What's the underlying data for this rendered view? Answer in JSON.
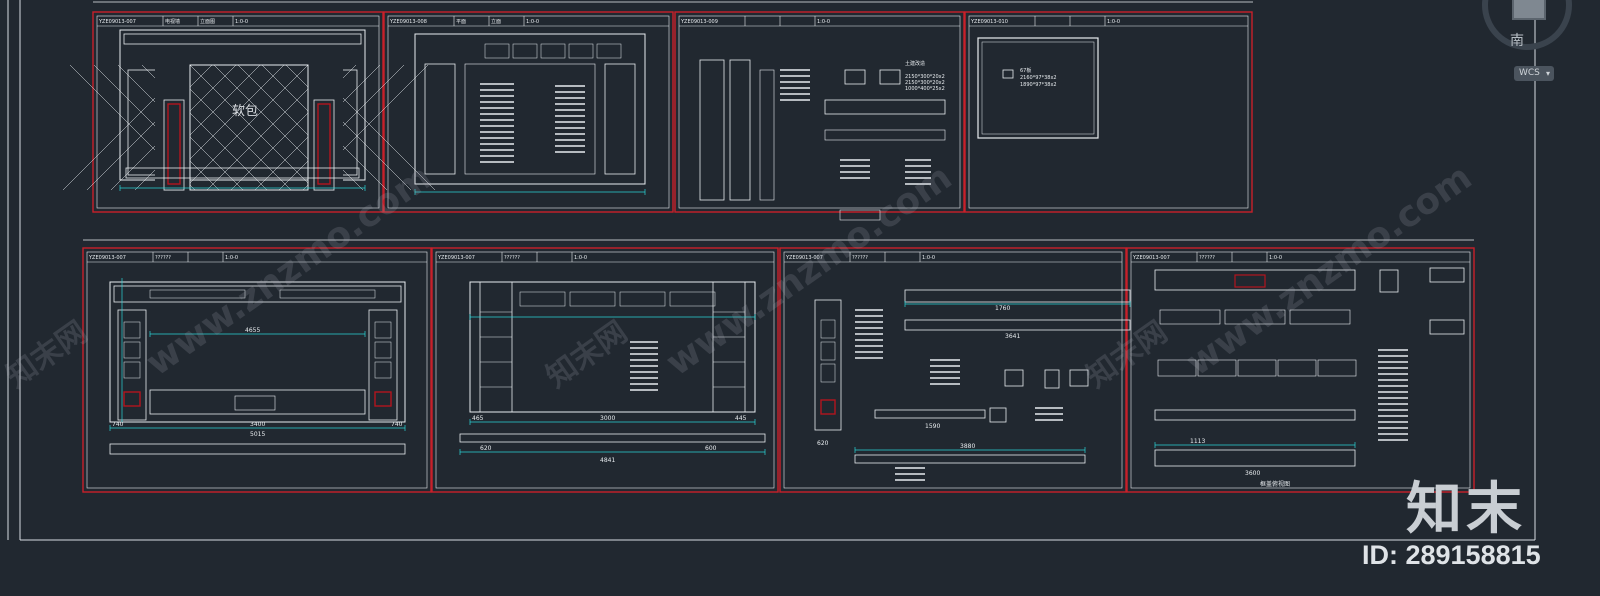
{
  "viewcube": {
    "compass_label": "南",
    "wcs_label": "WCS",
    "wcs_arrow": "▾"
  },
  "colors": {
    "background": "#212830",
    "sheet_border_red": "#c8202a",
    "line_white": "#e8ecef",
    "dim_cyan": "#2bd3d6",
    "accent_red": "#b3141e"
  },
  "sheets": [
    {
      "id": "s1",
      "title_block": [
        "YZE09013-007",
        "电视墙",
        "立面图",
        "1:0-0"
      ],
      "annotations": [
        "软包"
      ]
    },
    {
      "id": "s2",
      "title_block": [
        "YZE09013-008",
        "平面",
        "立面",
        "1:0-0"
      ]
    },
    {
      "id": "s3",
      "title_block": [
        "YZE09013-009",
        "",
        "",
        "1:0-0"
      ],
      "annotations": [
        "土建改造",
        "2150*300*20x2",
        "2150*300*20x2",
        "1000*400*25x2"
      ]
    },
    {
      "id": "s4",
      "title_block": [
        "YZE09013-010",
        "",
        "",
        "1:0-0"
      ],
      "annotations": [
        "67板",
        "2160*97*38x2",
        "1890*97*38x2"
      ]
    },
    {
      "id": "s5",
      "title_block": [
        "YZE09013-007",
        "??????",
        "",
        "1:0-0"
      ],
      "annotations": [
        "4655",
        "3400",
        "740",
        "740",
        "5015"
      ]
    },
    {
      "id": "s6",
      "title_block": [
        "YZE09013-007",
        "??????",
        "",
        "1:0-0"
      ],
      "annotations": [
        "3000",
        "465",
        "445",
        "4841",
        "600",
        "620"
      ]
    },
    {
      "id": "s7",
      "title_block": [
        "YZE09013-007",
        "??????",
        "",
        "1:0-0"
      ],
      "annotations": [
        "1760",
        "3641",
        "1590",
        "3880",
        "620"
      ]
    },
    {
      "id": "s8",
      "title_block": [
        "YZE09013-007",
        "??????",
        "",
        "1:0-0"
      ],
      "annotations": [
        "3600",
        "1113",
        "框盖俯视图"
      ]
    }
  ],
  "watermark": {
    "site": "www.znzmo.com",
    "brand": "知末网"
  },
  "branding": {
    "logo": "知末",
    "id_label": "ID: 289158815"
  }
}
